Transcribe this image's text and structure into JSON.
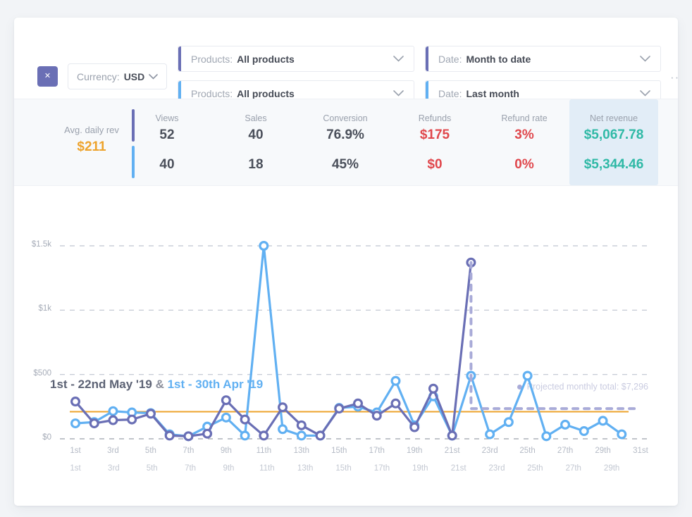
{
  "filters": {
    "close_label": "✕",
    "currency": {
      "label": "Currency:",
      "value": "USD"
    },
    "product_filters": [
      {
        "label": "Products:",
        "value": "All products",
        "accent": "#6a6fb5"
      },
      {
        "label": "Products:",
        "value": "All products",
        "accent": "#61b0f2"
      }
    ],
    "date_filters": [
      {
        "label": "Date:",
        "value": "Month to date",
        "accent": "#6a6fb5"
      },
      {
        "label": "Date:",
        "value": "Last month",
        "accent": "#61b0f2"
      }
    ],
    "overflow_menu": "···"
  },
  "stats": {
    "avg": {
      "title": "Avg. daily rev",
      "value": "$211",
      "color": "#eda32c"
    },
    "columns": [
      {
        "title": "Views",
        "row1": "52",
        "row2": "40",
        "color": "dark",
        "highlight": false
      },
      {
        "title": "Sales",
        "row1": "40",
        "row2": "18",
        "color": "dark",
        "highlight": false
      },
      {
        "title": "Conversion",
        "row1": "76.9%",
        "row2": "45%",
        "color": "dark",
        "highlight": false
      },
      {
        "title": "Refunds",
        "row1": "$175",
        "row2": "$0",
        "color": "red",
        "highlight": false
      },
      {
        "title": "Refund rate",
        "row1": "3%",
        "row2": "0%",
        "color": "red",
        "highlight": false
      },
      {
        "title": "Net revenue",
        "row1": "$5,067.78",
        "row2": "$5,344.46",
        "color": "teal",
        "highlight": true
      }
    ]
  },
  "chart_header": {
    "range_current": "1st - 22nd May '19",
    "amp": "&",
    "range_previous": "1st - 30th Apr '19",
    "projection_note": "Projected monthly total: $7,296"
  },
  "chart_data": {
    "type": "line",
    "title": "1st - 22nd May '19 & 1st - 30th Apr '19",
    "xlabel": "",
    "ylabel": "",
    "ylim": [
      0,
      1500
    ],
    "yticks": [
      0,
      500,
      1000,
      1500
    ],
    "ytick_labels": [
      "$0",
      "$500",
      "$1k",
      "$1.5k"
    ],
    "grid": "horizontal-dashed",
    "legend": "inline-title",
    "x_axis_top": {
      "days": [
        1,
        2,
        3,
        4,
        5,
        6,
        7,
        8,
        9,
        10,
        11,
        12,
        13,
        14,
        15,
        16,
        17,
        18,
        19,
        20,
        21,
        22,
        23,
        24,
        25,
        26,
        27,
        28,
        29,
        30,
        31
      ],
      "tick_labels": [
        "1st",
        "3rd",
        "5th",
        "7th",
        "9th",
        "11th",
        "13th",
        "15th",
        "17th",
        "19th",
        "21st",
        "23rd",
        "25th",
        "27th",
        "29th",
        "31st"
      ]
    },
    "x_axis_bottom": {
      "days": [
        1,
        2,
        3,
        4,
        5,
        6,
        7,
        8,
        9,
        10,
        11,
        12,
        13,
        14,
        15,
        16,
        17,
        18,
        19,
        20,
        21,
        22,
        23,
        24,
        25,
        26,
        27,
        28,
        29,
        30
      ],
      "tick_labels": [
        "1st",
        "3rd",
        "5th",
        "7th",
        "9th",
        "11th",
        "13th",
        "15th",
        "17th",
        "19th",
        "21st",
        "23rd",
        "25th",
        "27th",
        "29th"
      ]
    },
    "series": [
      {
        "name": "1st - 22nd May '19",
        "color": "#6a6fb5",
        "values": [
          290,
          120,
          145,
          150,
          195,
          25,
          20,
          40,
          300,
          150,
          25,
          245,
          105,
          25,
          235,
          275,
          180,
          275,
          90,
          390,
          25,
          1370
        ]
      },
      {
        "name": "1st - 30th Apr '19",
        "color": "#61b0f2",
        "values": [
          120,
          130,
          215,
          205,
          200,
          35,
          20,
          95,
          165,
          25,
          1500,
          75,
          25,
          25,
          240,
          250,
          205,
          450,
          105,
          330,
          25,
          490,
          35,
          130,
          490,
          20,
          110,
          60,
          140,
          35
        ]
      }
    ],
    "average_line": {
      "label": "Avg. daily rev",
      "value": 211,
      "color": "#eda32c"
    },
    "projection": {
      "label": "Projected monthly total: $7,296",
      "color": "#a9abd8",
      "style": "dashed",
      "from_day": 22,
      "to_day": 31,
      "level": 235
    }
  }
}
